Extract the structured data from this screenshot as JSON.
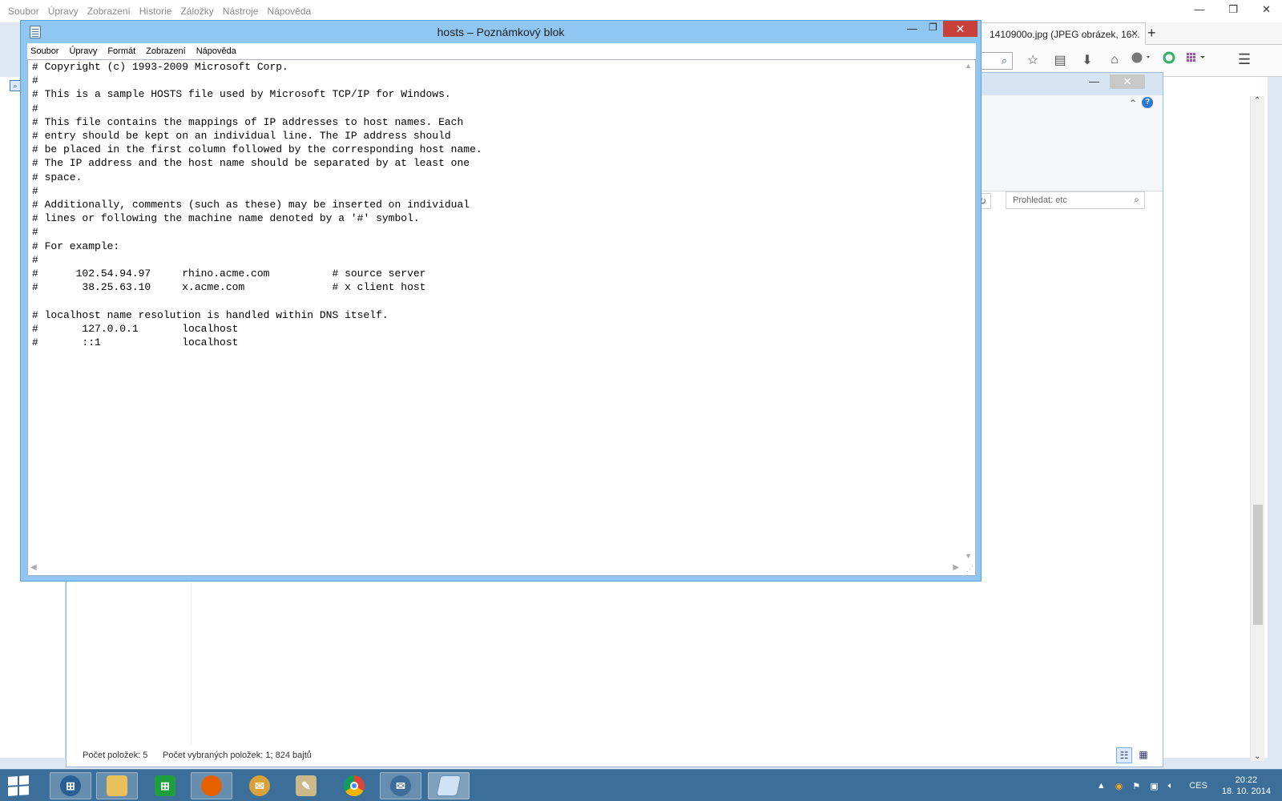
{
  "firefox": {
    "menu": [
      "Soubor",
      "Úpravy",
      "Zobrazení",
      "Historie",
      "Záložky",
      "Nástroje",
      "Nápověda"
    ],
    "window_controls": [
      "—",
      "❐",
      "✕"
    ],
    "tab_title": "1410900o.jpg (JPEG obrázek, 16...",
    "tab_close": "✕",
    "new_tab": "+",
    "nav_icons": [
      "star-icon",
      "reading-list-icon",
      "download-icon",
      "home-icon",
      "adblock-plus-icon",
      "ghostery-icon",
      "apps-grid-icon"
    ],
    "menu_button": "☰"
  },
  "explorer": {
    "search_placeholder": "Prohledat: etc",
    "status_items": "Počet položek: 5",
    "status_selection": "Počet vybraných položek: 1; 824 bajtů"
  },
  "notepad": {
    "title": "hosts – Poznámkový blok",
    "menu": [
      "Soubor",
      "Úpravy",
      "Formát",
      "Zobrazení",
      "Nápověda"
    ],
    "content": "# Copyright (c) 1993-2009 Microsoft Corp.\n#\n# This is a sample HOSTS file used by Microsoft TCP/IP for Windows.\n#\n# This file contains the mappings of IP addresses to host names. Each\n# entry should be kept on an individual line. The IP address should\n# be placed in the first column followed by the corresponding host name.\n# The IP address and the host name should be separated by at least one\n# space.\n#\n# Additionally, comments (such as these) may be inserted on individual\n# lines or following the machine name denoted by a '#' symbol.\n#\n# For example:\n#\n#      102.54.94.97     rhino.acme.com          # source server\n#       38.25.63.10     x.acme.com              # x client host\n\n# localhost name resolution is handled within DNS itself.\n#\t127.0.0.1       localhost\n#\t::1             localhost"
  },
  "taskbar": {
    "apps": [
      "file-explorer",
      "windows-store",
      "firefox",
      "thunderbird",
      "paint",
      "chrome",
      "mail",
      "notepad"
    ],
    "language": "CES",
    "time": "20:22",
    "date": "18. 10. 2014"
  }
}
